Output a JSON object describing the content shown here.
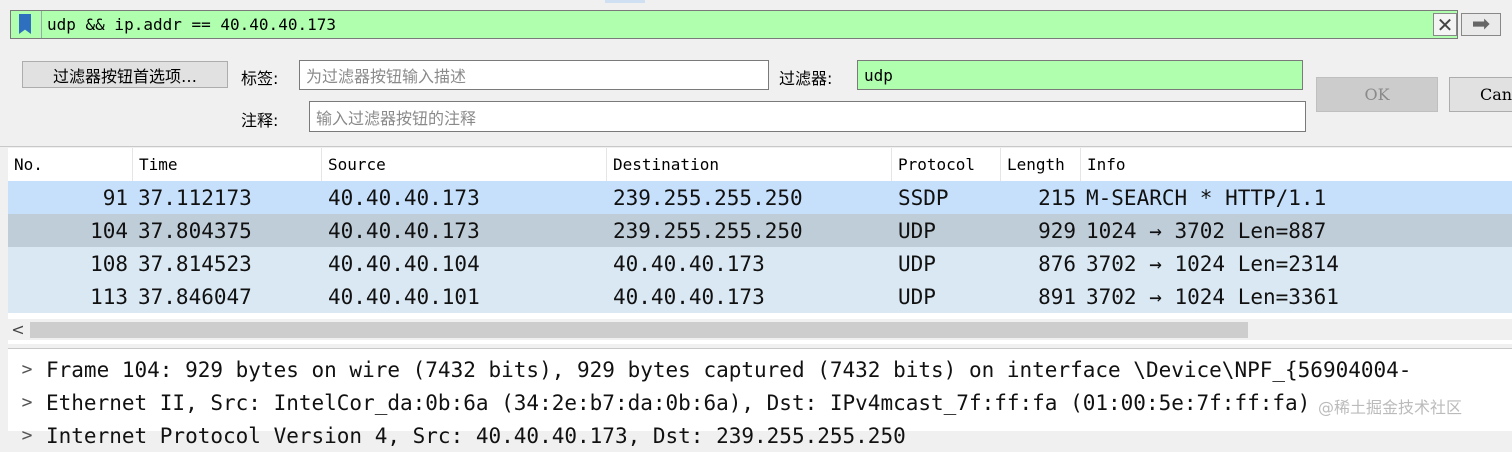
{
  "filter": {
    "text": "udp && ip.addr == 40.40.40.173",
    "clear_icon": "✕",
    "apply_icon": "➡"
  },
  "editor": {
    "prefs_button": "过滤器按钮首选项…",
    "label_label": "标签:",
    "label_placeholder": "为过滤器按钮输入描述",
    "filter_label": "过滤器:",
    "filter_value": "udp",
    "comment_label": "注释:",
    "comment_placeholder": "输入过滤器按钮的注释",
    "ok_button": "OK",
    "cancel_button": "Canc"
  },
  "packet_list": {
    "columns": [
      "No.",
      "Time",
      "Source",
      "Destination",
      "Protocol",
      "Length",
      "Info"
    ],
    "rows": [
      {
        "no": "91",
        "time": "37.112173",
        "source": "40.40.40.173",
        "destination": "239.255.255.250",
        "protocol": "SSDP",
        "length": "215",
        "info": "M-SEARCH * HTTP/1.1"
      },
      {
        "no": "104",
        "time": "37.804375",
        "source": "40.40.40.173",
        "destination": "239.255.255.250",
        "protocol": "UDP",
        "length": "929",
        "info": "1024 → 3702 Len=887"
      },
      {
        "no": "108",
        "time": "37.814523",
        "source": "40.40.40.104",
        "destination": "40.40.40.173",
        "protocol": "UDP",
        "length": "876",
        "info": "3702 → 1024 Len=2314"
      },
      {
        "no": "113",
        "time": "37.846047",
        "source": "40.40.40.101",
        "destination": "40.40.40.173",
        "protocol": "UDP",
        "length": "891",
        "info": "3702 → 1024 Len=3361"
      }
    ],
    "row_colors": {
      "normal": "#dae8f4",
      "first": "#c6e0fb",
      "selected": "#bfcdd9"
    }
  },
  "details": {
    "lines": [
      "Frame 104: 929 bytes on wire (7432 bits), 929 bytes captured (7432 bits) on interface \\Device\\NPF_{56904004-",
      "Ethernet II, Src: IntelCor_da:0b:6a (34:2e:b7:da:0b:6a), Dst: IPv4mcast_7f:ff:fa (01:00:5e:7f:ff:fa)",
      "Internet Protocol Version 4, Src: 40.40.40.173, Dst: 239.255.255.250"
    ],
    "expander": ">"
  },
  "watermark": "@稀土掘金技术社区"
}
